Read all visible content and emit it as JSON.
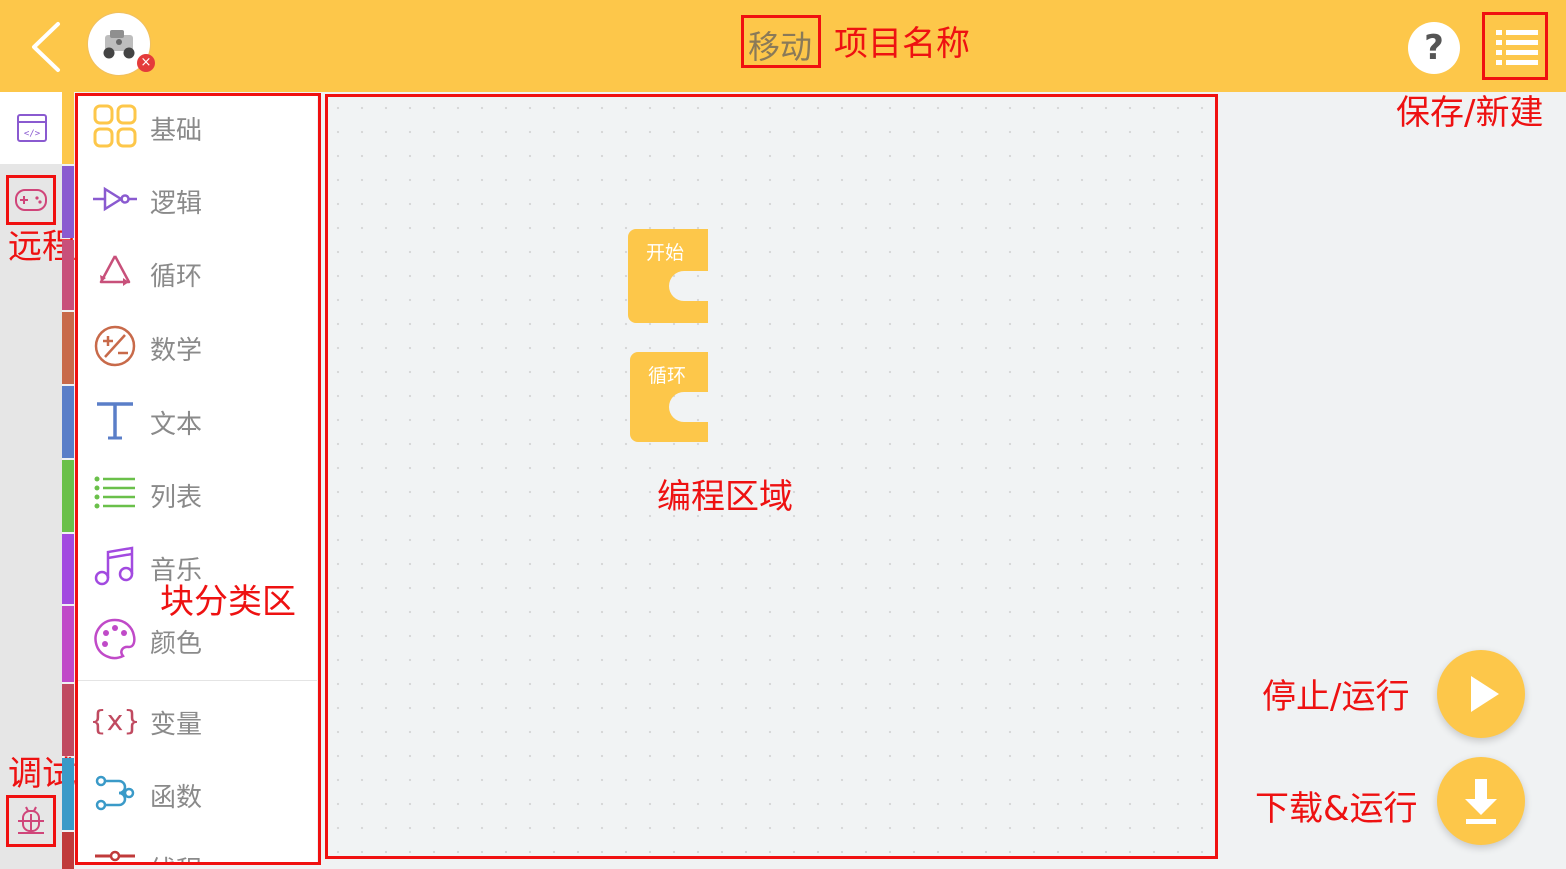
{
  "header": {
    "project_name": "移动",
    "project_name_annotation": "项目名称",
    "help_label": "?",
    "save_new_annotation": "保存/新建"
  },
  "left_sidebar": {
    "remote_control_annotation": "远程控制",
    "debugger_annotation": "调试器"
  },
  "palette": {
    "annotation": "块分类区",
    "categories": [
      {
        "label": "基础",
        "icon": "grid-icon",
        "color": "#fdc74a"
      },
      {
        "label": "逻辑",
        "icon": "logic-gate-icon",
        "color": "#8a5ad0"
      },
      {
        "label": "循环",
        "icon": "loop-arrows-icon",
        "color": "#c8507a"
      },
      {
        "label": "数学",
        "icon": "math-icon",
        "color": "#c86a4a"
      },
      {
        "label": "文本",
        "icon": "text-t-icon",
        "color": "#5a7ec8"
      },
      {
        "label": "列表",
        "icon": "list-icon",
        "color": "#6ac04a"
      },
      {
        "label": "音乐",
        "icon": "music-note-icon",
        "color": "#a24ae0"
      },
      {
        "label": "颜色",
        "icon": "palette-icon",
        "color": "#c04ac8"
      },
      {
        "label": "变量",
        "icon": "variable-x-icon",
        "color": "#c04a60"
      },
      {
        "label": "函数",
        "icon": "function-flow-icon",
        "color": "#3a9ac8"
      },
      {
        "label": "线程",
        "icon": "thread-icon",
        "color": "#c03a3a"
      }
    ]
  },
  "workspace": {
    "annotation": "编程区域",
    "blocks": [
      {
        "label": "开始"
      },
      {
        "label": "循环"
      }
    ]
  },
  "controls": {
    "stop_run_annotation": "停止/运行",
    "download_run_annotation": "下载&运行"
  },
  "colors": {
    "accent": "#fdc74a",
    "annotation_red": "#f01010"
  }
}
